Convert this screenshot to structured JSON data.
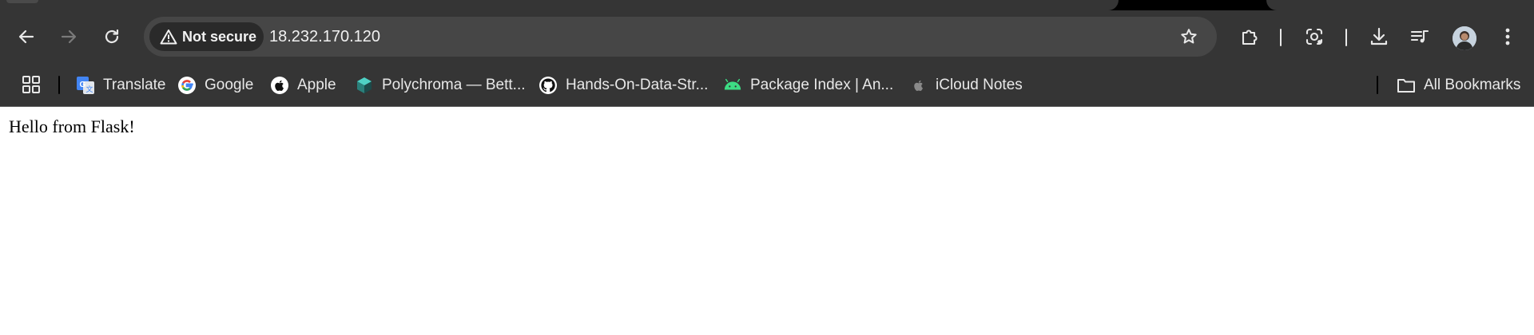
{
  "browser": {
    "security_label": "Not secure",
    "url": "18.232.170.120",
    "icons": [
      "back-icon",
      "forward-icon",
      "reload-icon",
      "warning-icon",
      "star-icon",
      "extensions-icon",
      "lens-icon",
      "download-icon",
      "media-control-icon",
      "avatar",
      "menu-icon"
    ]
  },
  "bookmarks": {
    "items": [
      {
        "label": "Translate",
        "icon": "translate-icon"
      },
      {
        "label": "Google",
        "icon": "google-icon"
      },
      {
        "label": "Apple",
        "icon": "apple-icon"
      },
      {
        "label": "Polychroma — Bett...",
        "icon": "polychroma-icon"
      },
      {
        "label": "Hands-On-Data-Str...",
        "icon": "github-icon"
      },
      {
        "label": "Package Index  |  An...",
        "icon": "android-icon"
      },
      {
        "label": "iCloud Notes",
        "icon": "apple-gray-icon"
      }
    ],
    "all_bookmarks_label": "All Bookmarks"
  },
  "page": {
    "body_text": "Hello from Flask!"
  },
  "colors": {
    "chrome_bg": "#353535",
    "omnibox_bg": "#464646",
    "tabstrip_bg": "#000000",
    "text_light": "#e8e8e8",
    "page_bg": "#ffffff"
  }
}
